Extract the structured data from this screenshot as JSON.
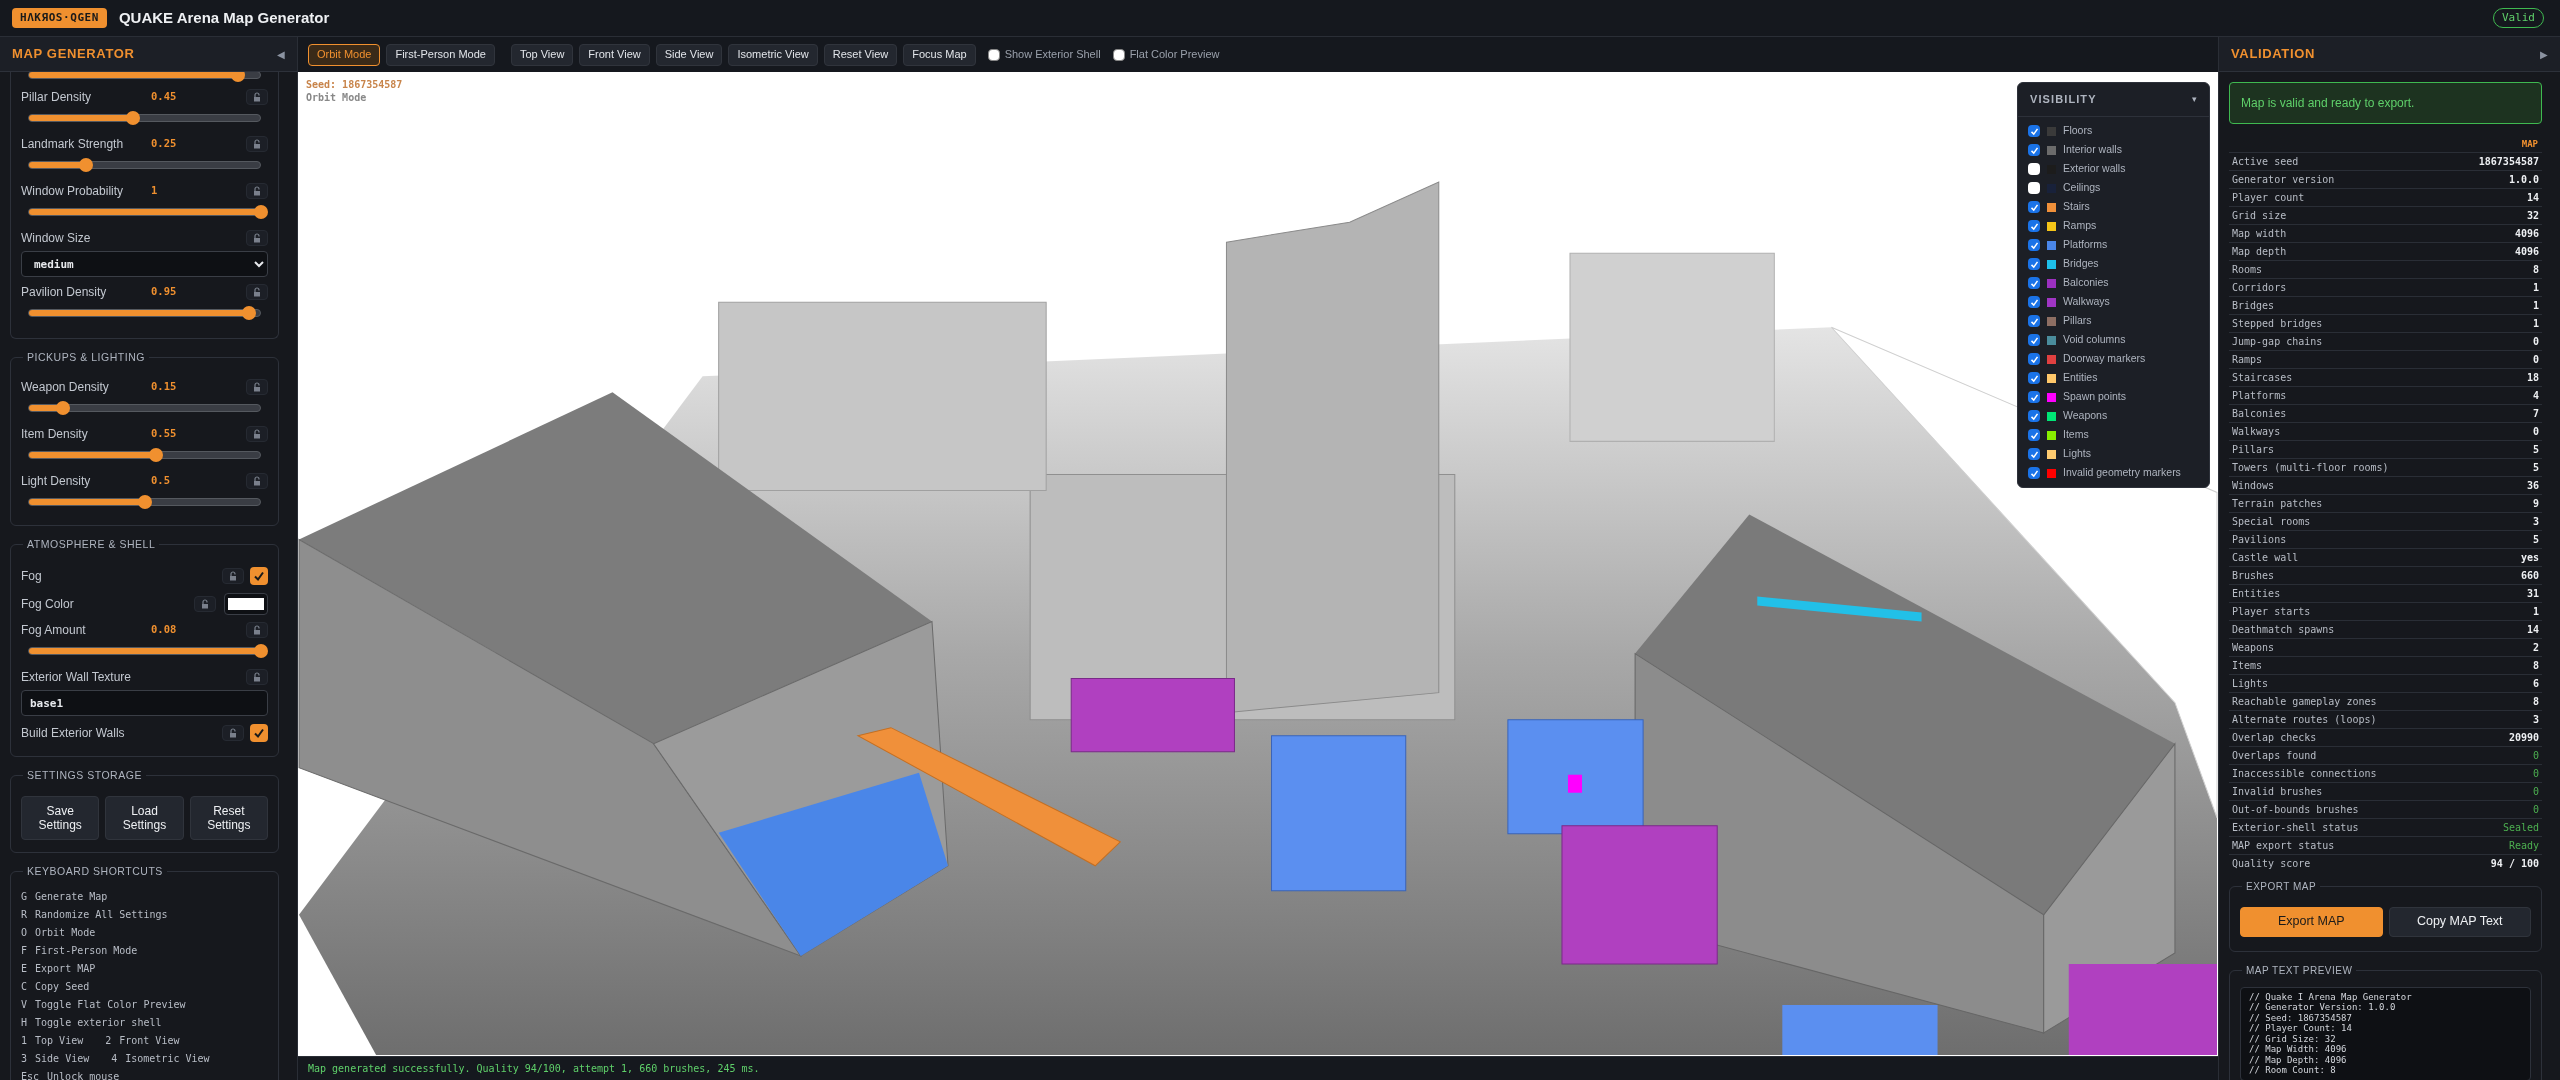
{
  "app": {
    "logo": "HΛKЯOS·QGEN",
    "title": "QUAKE Arena Map Generator",
    "status_badge": "Valid"
  },
  "left_panel": {
    "title": "MAP GENERATOR",
    "collapse_icon": "◀",
    "partial_slider": {
      "level": 0.9
    },
    "sections": [
      {
        "items": [
          {
            "kind": "slider",
            "label": "Pillar Density",
            "reading": "0.45",
            "level": 0.45,
            "locked": false
          },
          {
            "kind": "slider",
            "label": "Landmark Strength",
            "reading": "0.25",
            "level": 0.25,
            "locked": false
          },
          {
            "kind": "slider",
            "label": "Window Probability",
            "reading": "1",
            "level": 1,
            "locked": false
          },
          {
            "kind": "select",
            "label": "Window Size",
            "value": "medium",
            "locked": false
          },
          {
            "kind": "slider",
            "label": "Pavilion Density",
            "reading": "0.95",
            "level": 0.95,
            "locked": false
          }
        ]
      },
      {
        "title": "PICKUPS & LIGHTING",
        "items": [
          {
            "kind": "slider",
            "label": "Weapon Density",
            "reading": "0.15",
            "level": 0.15,
            "locked": false
          },
          {
            "kind": "slider",
            "label": "Item Density",
            "reading": "0.55",
            "level": 0.55,
            "locked": false
          },
          {
            "kind": "slider",
            "label": "Light Density",
            "reading": "0.5",
            "level": 0.5,
            "locked": false
          }
        ]
      },
      {
        "title": "ATMOSPHERE & SHELL",
        "items": [
          {
            "kind": "toggle",
            "label": "Fog",
            "checked": true,
            "locked": false
          },
          {
            "kind": "color",
            "label": "Fog Color",
            "color": "#ffffff",
            "locked": false
          },
          {
            "kind": "slider",
            "label": "Fog Amount",
            "reading": "0.08",
            "level": 1,
            "locked": false
          },
          {
            "kind": "text",
            "label": "Exterior Wall Texture",
            "value": "base1",
            "locked": false
          },
          {
            "kind": "toggle",
            "label": "Build Exterior Walls",
            "checked": true,
            "locked": false
          }
        ]
      },
      {
        "title": "SETTINGS STORAGE",
        "items": [
          {
            "kind": "buttons",
            "buttons": [
              "Save Settings",
              "Load Settings",
              "Reset Settings"
            ]
          }
        ]
      },
      {
        "title": "KEYBOARD SHORTCUTS",
        "items": [
          {
            "kind": "shortcuts",
            "rows": [
              [
                {
                  "key": "G",
                  "action": "Generate Map"
                }
              ],
              [
                {
                  "key": "R",
                  "action": "Randomize All Settings"
                }
              ],
              [
                {
                  "key": "O",
                  "action": "Orbit Mode"
                }
              ],
              [
                {
                  "key": "F",
                  "action": "First-Person Mode"
                }
              ],
              [
                {
                  "key": "E",
                  "action": "Export MAP"
                }
              ],
              [
                {
                  "key": "C",
                  "action": "Copy Seed"
                }
              ],
              [
                {
                  "key": "V",
                  "action": "Toggle Flat Color Preview"
                }
              ],
              [
                {
                  "key": "H",
                  "action": "Toggle exterior shell"
                }
              ],
              [
                {
                  "key": "1",
                  "action": "Top View"
                },
                {
                  "key": "2",
                  "action": "Front View"
                }
              ],
              [
                {
                  "key": "3",
                  "action": "Side View"
                },
                {
                  "key": "4",
                  "action": "Isometric View"
                }
              ],
              [
                {
                  "key": "Esc",
                  "action": "Unlock mouse"
                }
              ]
            ]
          }
        ]
      }
    ]
  },
  "toolbar": {
    "buttons": [
      {
        "label": "Orbit Mode",
        "selected": true
      },
      {
        "label": "First-Person Mode",
        "selected": false
      },
      {
        "label": "Top View",
        "selected": false
      },
      {
        "label": "Front View",
        "selected": false
      },
      {
        "label": "Side View",
        "selected": false
      },
      {
        "label": "Isometric View",
        "selected": false
      },
      {
        "label": "Reset View",
        "selected": false
      },
      {
        "label": "Focus Map",
        "selected": false
      }
    ],
    "checkboxes": [
      {
        "label": "Show Exterior Shell",
        "checked": false
      },
      {
        "label": "Flat Color Preview",
        "checked": false
      }
    ]
  },
  "viewport": {
    "seed": "Seed: 1867354587",
    "mode": "Orbit Mode",
    "visibility": {
      "title": "VISIBILITY",
      "toggle_icon": "▾",
      "layers": [
        {
          "label": "Floors",
          "checked": true,
          "color": "#3a3a3a"
        },
        {
          "label": "Interior walls",
          "checked": true,
          "color": "#6b6b6b"
        },
        {
          "label": "Exterior walls",
          "checked": false,
          "color": "#1c1c1c"
        },
        {
          "label": "Ceilings",
          "checked": false,
          "color": "#18213a"
        },
        {
          "label": "Stairs",
          "checked": true,
          "color": "#f0903a"
        },
        {
          "label": "Ramps",
          "checked": true,
          "color": "#f5c518"
        },
        {
          "label": "Platforms",
          "checked": true,
          "color": "#4a86e8"
        },
        {
          "label": "Bridges",
          "checked": true,
          "color": "#1ec0ea"
        },
        {
          "label": "Balconies",
          "checked": true,
          "color": "#9c30c0"
        },
        {
          "label": "Walkways",
          "checked": true,
          "color": "#a035c4"
        },
        {
          "label": "Pillars",
          "checked": true,
          "color": "#8d6e63"
        },
        {
          "label": "Void columns",
          "checked": true,
          "color": "#4a8c9c"
        },
        {
          "label": "Doorway markers",
          "checked": true,
          "color": "#e04040"
        },
        {
          "label": "Entities",
          "checked": true,
          "color": "#ffc86a"
        },
        {
          "label": "Spawn points",
          "checked": true,
          "color": "#ff00ff"
        },
        {
          "label": "Weapons",
          "checked": true,
          "color": "#00e676"
        },
        {
          "label": "Items",
          "checked": true,
          "color": "#88ee00"
        },
        {
          "label": "Lights",
          "checked": true,
          "color": "#ffcc70"
        },
        {
          "label": "Invalid geometry markers",
          "checked": true,
          "color": "#ff0000"
        }
      ]
    }
  },
  "status_bar": "Map generated successfully. Quality 94/100, attempt 1, 660 brushes, 245 ms.",
  "right_panel": {
    "title": "VALIDATION",
    "collapse_icon": "▶",
    "alert": "Map is valid and ready to export.",
    "table_header": "MAP",
    "rows": [
      {
        "label": "Active seed",
        "value": "1867354587",
        "success": false
      },
      {
        "label": "Generator version",
        "value": "1.0.0",
        "success": false
      },
      {
        "label": "Player count",
        "value": "14",
        "success": false
      },
      {
        "label": "Grid size",
        "value": "32",
        "success": false
      },
      {
        "label": "Map width",
        "value": "4096",
        "success": false
      },
      {
        "label": "Map depth",
        "value": "4096",
        "success": false
      },
      {
        "label": "Rooms",
        "value": "8",
        "success": false
      },
      {
        "label": "Corridors",
        "value": "1",
        "success": false
      },
      {
        "label": "Bridges",
        "value": "1",
        "success": false
      },
      {
        "label": "Stepped bridges",
        "value": "1",
        "success": false
      },
      {
        "label": "Jump-gap chains",
        "value": "0",
        "success": false
      },
      {
        "label": "Ramps",
        "value": "0",
        "success": false
      },
      {
        "label": "Staircases",
        "value": "18",
        "success": false
      },
      {
        "label": "Platforms",
        "value": "4",
        "success": false
      },
      {
        "label": "Balconies",
        "value": "7",
        "success": false
      },
      {
        "label": "Walkways",
        "value": "0",
        "success": false
      },
      {
        "label": "Pillars",
        "value": "5",
        "success": false
      },
      {
        "label": "Towers (multi-floor rooms)",
        "value": "5",
        "success": false
      },
      {
        "label": "Windows",
        "value": "36",
        "success": false
      },
      {
        "label": "Terrain patches",
        "value": "9",
        "success": false
      },
      {
        "label": "Special rooms",
        "value": "3",
        "success": false
      },
      {
        "label": "Pavilions",
        "value": "5",
        "success": false
      },
      {
        "label": "Castle wall",
        "value": "yes",
        "success": false
      },
      {
        "label": "Brushes",
        "value": "660",
        "success": false
      },
      {
        "label": "Entities",
        "value": "31",
        "success": false
      },
      {
        "label": "Player starts",
        "value": "1",
        "success": false
      },
      {
        "label": "Deathmatch spawns",
        "value": "14",
        "success": false
      },
      {
        "label": "Weapons",
        "value": "2",
        "success": false
      },
      {
        "label": "Items",
        "value": "8",
        "success": false
      },
      {
        "label": "Lights",
        "value": "6",
        "success": false
      },
      {
        "label": "Reachable gameplay zones",
        "value": "8",
        "success": false
      },
      {
        "label": "Alternate routes (loops)",
        "value": "3",
        "success": false
      },
      {
        "label": "Overlap checks",
        "value": "20990",
        "success": false
      },
      {
        "label": "Overlaps found",
        "value": "0",
        "success": true
      },
      {
        "label": "Inaccessible connections",
        "value": "0",
        "success": true
      },
      {
        "label": "Invalid brushes",
        "value": "0",
        "success": true
      },
      {
        "label": "Out-of-bounds brushes",
        "value": "0",
        "success": true
      },
      {
        "label": "Exterior-shell status",
        "value": "Sealed",
        "success": true
      },
      {
        "label": "MAP export status",
        "value": "Ready",
        "success": true
      },
      {
        "label": "Quality score",
        "value": "94 / 100",
        "success": false
      }
    ],
    "export": {
      "title": "EXPORT MAP",
      "buttons": [
        {
          "label": "Export MAP",
          "kind": "primary"
        },
        {
          "label": "Copy MAP Text",
          "kind": "secondary"
        }
      ]
    },
    "preview": {
      "title": "MAP TEXT PREVIEW",
      "lines": [
        "// Quake I Arena Map Generator",
        "// Generator Version: 1.0.0",
        "// Seed: 1867354587",
        "// Player Count: 14",
        "// Grid Size: 32",
        "// Map Width: 4096",
        "// Map Depth: 4096",
        "// Room Count: 8"
      ]
    }
  }
}
